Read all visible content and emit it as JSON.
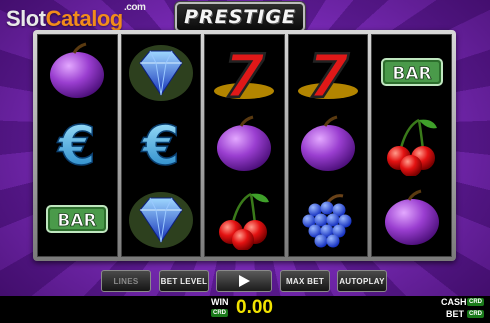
{
  "logo": {
    "slot": "Slot",
    "catalog": "Catalog",
    "dotcom": ".com"
  },
  "title": "PRESTIGE",
  "reels": [
    [
      "plum-icon",
      "euro-icon",
      "bar-icon"
    ],
    [
      "diamond-icon",
      "euro-icon",
      "diamond-icon"
    ],
    [
      "seven-icon",
      "plum-icon",
      "cherry-icon"
    ],
    [
      "seven-icon",
      "plum-icon",
      "grapes-icon"
    ],
    [
      "bar-icon",
      "cherry-icon",
      "plum-icon"
    ]
  ],
  "symbol_text": {
    "bar": "BAR",
    "seven": "7"
  },
  "buttons": {
    "lines": "LINES",
    "bet_level": "BET LEVEL",
    "max_bet": "MAX BET",
    "autoplay": "AUTOPLAY"
  },
  "status": {
    "win_label": "WIN",
    "win_value": "0.00",
    "crd": "CRD",
    "cash_label": "CASH",
    "bet_label": "BET"
  },
  "colors": {
    "accent_win": "#f2e300",
    "crd_badge": "#1a7a1a"
  }
}
